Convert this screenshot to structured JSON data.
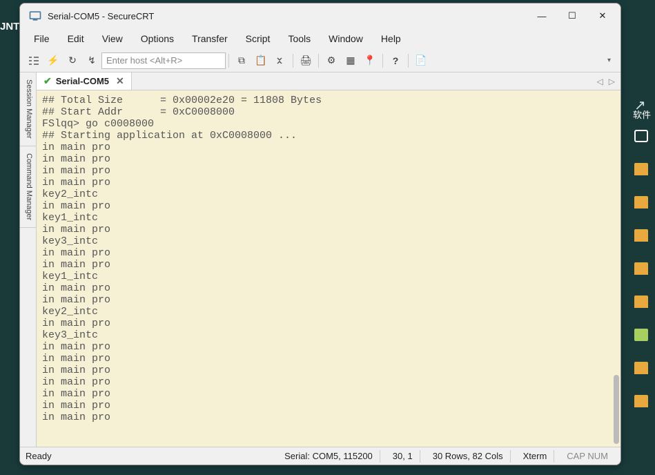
{
  "window": {
    "title": "Serial-COM5 - SecureCRT"
  },
  "menu": {
    "file": "File",
    "edit": "Edit",
    "view": "View",
    "options": "Options",
    "transfer": "Transfer",
    "script": "Script",
    "tools": "Tools",
    "window": "Window",
    "help": "Help"
  },
  "toolbar": {
    "host_placeholder": "Enter host <Alt+R>"
  },
  "side": {
    "session_manager": "Session Manager",
    "command_manager": "Command Manager"
  },
  "tab": {
    "label": "Serial-COM5"
  },
  "terminal_lines": [
    "## Total Size      = 0x00002e20 = 11808 Bytes",
    "## Start Addr      = 0xC0008000",
    "FSlqq> go c0008000",
    "## Starting application at 0xC0008000 ...",
    "in main pro",
    "in main pro",
    "in main pro",
    "in main pro",
    "key2_intc",
    "in main pro",
    "key1_intc",
    "in main pro",
    "key3_intc",
    "in main pro",
    "in main pro",
    "key1_intc",
    "in main pro",
    "in main pro",
    "key2_intc",
    "in main pro",
    "key3_intc",
    "in main pro",
    "in main pro",
    "in main pro",
    "in main pro",
    "in main pro",
    "in main pro",
    "in main pro"
  ],
  "status": {
    "ready": "Ready",
    "conn": "Serial: COM5, 115200",
    "cursor": "30,  1",
    "size": "30 Rows, 82 Cols",
    "term": "Xterm",
    "caps": "CAP  NUM"
  },
  "bg": {
    "soft": "软件"
  }
}
